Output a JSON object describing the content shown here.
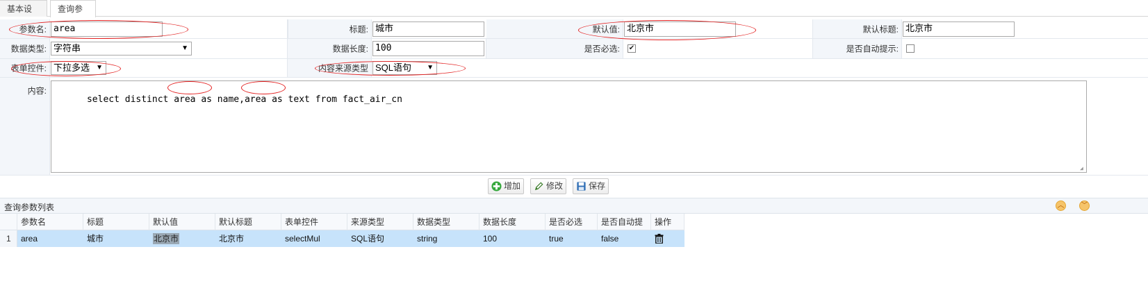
{
  "tabs": [
    "基本设置",
    "查询参数"
  ],
  "form": {
    "param_name": {
      "label": "参数名:",
      "value": "area"
    },
    "title": {
      "label": "标题:",
      "value": "城市"
    },
    "default_value": {
      "label": "默认值:",
      "value": "北京市"
    },
    "default_title": {
      "label": "默认标题:",
      "value": "北京市"
    },
    "data_type": {
      "label": "数据类型:",
      "value": "字符串"
    },
    "data_length": {
      "label": "数据长度:",
      "value": "100"
    },
    "required": {
      "label": "是否必选:",
      "checked": true
    },
    "auto_hint": {
      "label": "是否自动提示:",
      "checked": false
    },
    "form_control": {
      "label": "表单控件:",
      "value": "下拉多选"
    },
    "source_type": {
      "label": "内容来源类型",
      "value": "SQL语句"
    },
    "content": {
      "label": "内容:",
      "value": "select distinct area as name,area as text from fact_air_cn"
    }
  },
  "buttons": {
    "add": "增加",
    "edit": "修改",
    "save": "保存"
  },
  "grid": {
    "title": "查询参数列表",
    "columns": [
      "参数名",
      "标题",
      "默认值",
      "默认标题",
      "表单控件",
      "来源类型",
      "数据类型",
      "数据长度",
      "是否必选",
      "是否自动提示",
      "操作"
    ],
    "rows": [
      {
        "num": "1",
        "cells": [
          "area",
          "城市",
          "北京市",
          "北京市",
          "selectMul",
          "SQL语句",
          "string",
          "100",
          "true",
          "false"
        ]
      }
    ]
  },
  "colors": {
    "annotation": "#e32020",
    "selected_row": "#c7e3fb",
    "label_bg": "#f3f6fa"
  },
  "icons": {
    "add": "plus-icon",
    "edit": "pencil-icon",
    "save": "floppy-icon",
    "delete": "trash-icon",
    "collapse": "chevron-up-icon",
    "expand": "chevron-down-icon"
  }
}
